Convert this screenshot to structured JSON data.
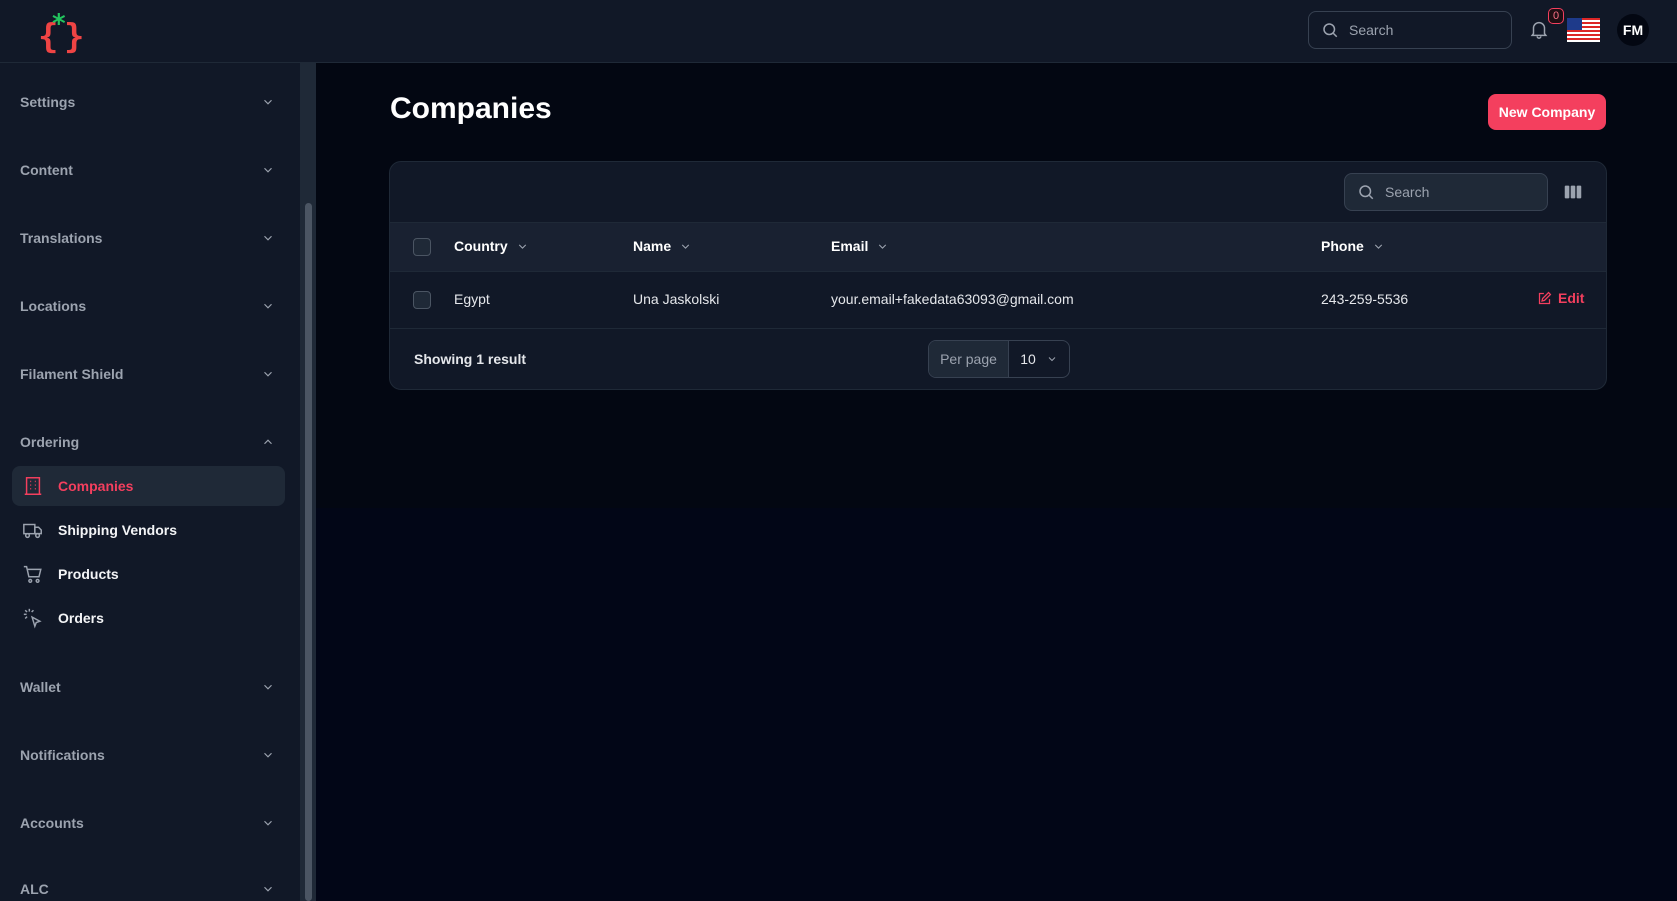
{
  "topbar": {
    "search_placeholder": "Search",
    "notification_count": "0",
    "avatar_initials": "FM"
  },
  "sidebar": {
    "groups": [
      {
        "label": "Settings",
        "expanded": false
      },
      {
        "label": "Content",
        "expanded": false
      },
      {
        "label": "Translations",
        "expanded": false
      },
      {
        "label": "Locations",
        "expanded": false
      },
      {
        "label": "Filament Shield",
        "expanded": false
      },
      {
        "label": "Ordering",
        "expanded": true
      },
      {
        "label": "Wallet",
        "expanded": false
      },
      {
        "label": "Notifications",
        "expanded": false
      },
      {
        "label": "Accounts",
        "expanded": false
      },
      {
        "label": "ALC",
        "expanded": false
      }
    ],
    "ordering_items": [
      {
        "label": "Companies",
        "icon": "building-icon",
        "active": true
      },
      {
        "label": "Shipping Vendors",
        "icon": "truck-icon",
        "active": false
      },
      {
        "label": "Products",
        "icon": "cart-icon",
        "active": false
      },
      {
        "label": "Orders",
        "icon": "cursor-click-icon",
        "active": false
      }
    ]
  },
  "main": {
    "title": "Companies",
    "new_button": "New Company",
    "table": {
      "search_placeholder": "Search",
      "columns": [
        "Country",
        "Name",
        "Email",
        "Phone"
      ],
      "rows": [
        {
          "country": "Egypt",
          "name": "Una Jaskolski",
          "email": "your.email+fakedata63093@gmail.com",
          "phone": "243-259-5536",
          "action": "Edit"
        }
      ],
      "footer": {
        "showing": "Showing 1 result",
        "per_page_label": "Per page",
        "per_page_value": "10"
      }
    }
  },
  "colors": {
    "accent": "#f43f5e",
    "background": "#030712",
    "panel": "#111827"
  }
}
